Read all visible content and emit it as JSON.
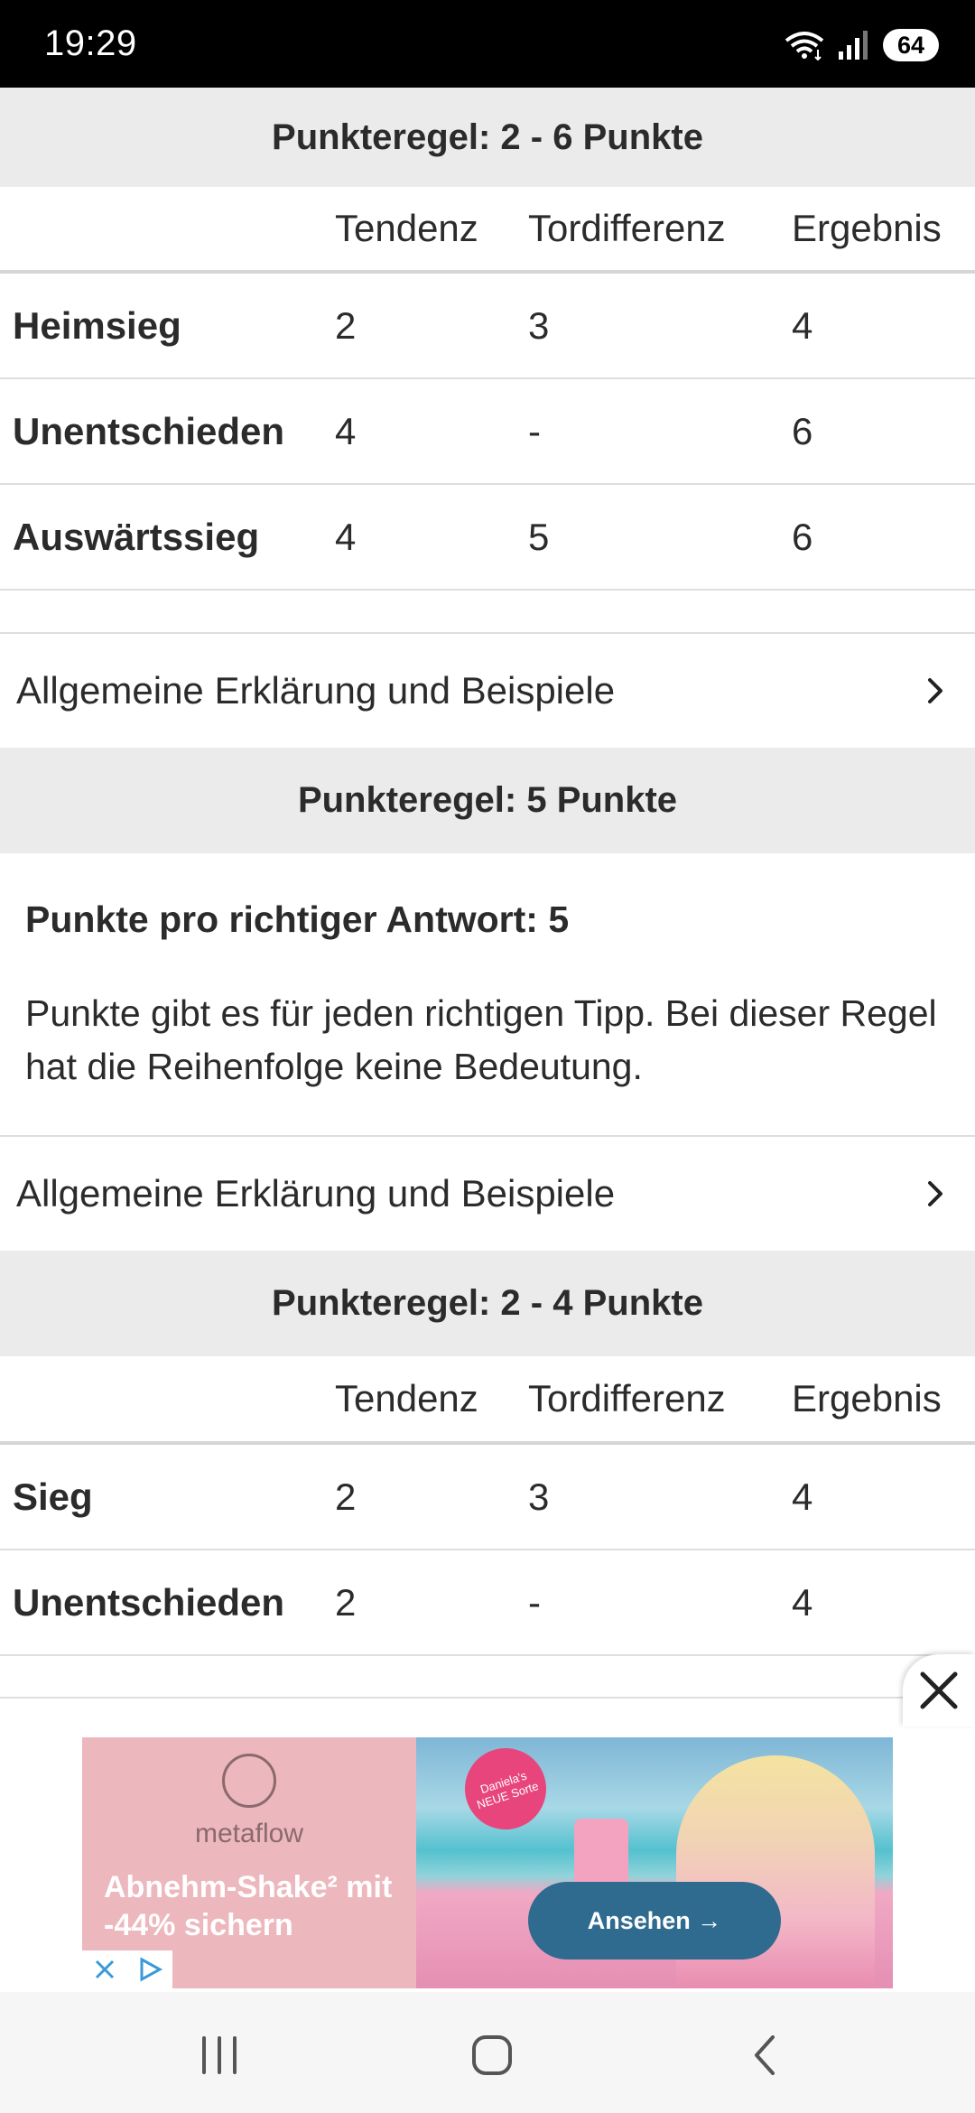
{
  "status_bar": {
    "time": "19:29",
    "battery": "64",
    "icons": [
      "wifi-icon",
      "signal-icon",
      "battery-icon"
    ]
  },
  "sections": [
    {
      "header": "Punkteregel: 2 - 6 Punkte",
      "columns": [
        "Tendenz",
        "Tordifferenz",
        "Ergebnis"
      ],
      "rows": [
        {
          "label": "Heimsieg",
          "values": [
            "2",
            "3",
            "4"
          ]
        },
        {
          "label": "Unentschieden",
          "values": [
            "4",
            "-",
            "6"
          ]
        },
        {
          "label": "Auswärtssieg",
          "values": [
            "4",
            "5",
            "6"
          ]
        }
      ],
      "link": "Allgemeine Erklärung und Beispiele"
    },
    {
      "header": "Punkteregel: 5 Punkte",
      "bold_text": "Punkte pro richtiger Antwort: 5",
      "body_text": "Punkte gibt es für jeden richtigen Tipp. Bei dieser Regel hat die Reihenfolge keine Bedeutung.",
      "link": "Allgemeine Erklärung und Beispiele"
    },
    {
      "header": "Punkteregel: 2 - 4 Punkte",
      "columns": [
        "Tendenz",
        "Tordifferenz",
        "Ergebnis"
      ],
      "rows": [
        {
          "label": "Sieg",
          "values": [
            "2",
            "3",
            "4"
          ]
        },
        {
          "label": "Unentschieden",
          "values": [
            "2",
            "-",
            "4"
          ]
        }
      ]
    }
  ],
  "ad": {
    "brand": "metaflow",
    "badge": "Daniela's NEUE Sorte",
    "headline": "Abnehm-Shake² mit -44% sichern",
    "cta": "Ansehen →",
    "colors": {
      "left_bg": "#ecb7bd",
      "cta_bg": "#2f6a8f"
    }
  },
  "nav": {
    "buttons": [
      "recent-apps-icon",
      "home-icon",
      "back-icon"
    ]
  }
}
